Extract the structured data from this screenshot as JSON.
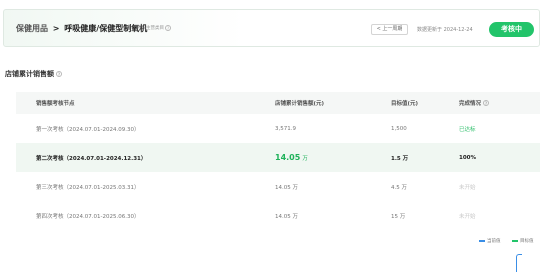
{
  "header": {
    "crumb_parent": "保健用品",
    "crumb_sep": ">",
    "crumb_current": "呼吸健康/保健型制氧机",
    "crumb_note": "考核主营类目",
    "period_button": "< 上一周期",
    "update_text": "数据更新于 2024-12-24",
    "status_label": "考核中",
    "status_color": "#22c46a"
  },
  "section": {
    "title": "店铺累计销售额"
  },
  "table": {
    "columns": [
      "销售额考核节点",
      "店铺累计销售额(元)",
      "目标值(元)",
      "完成情况"
    ],
    "rows": [
      {
        "node": "第一次考核（2024.07.01-2024.09.30）",
        "sales": "3,571.9",
        "sales_unit": "",
        "target": "1,500",
        "status": "已达标",
        "state": "done"
      },
      {
        "node": "第二次考核（2024.07.01-2024.12.31）",
        "sales": "14.05",
        "sales_unit": "万",
        "target": "1.5 万",
        "status": "100%",
        "state": "current"
      },
      {
        "node": "第三次考核（2024.07.01-2025.03.31）",
        "sales": "14.05 万",
        "sales_unit": "",
        "target": "4.5 万",
        "status": "未开始",
        "state": "pending"
      },
      {
        "node": "第四次考核（2024.07.01-2025.06.30）",
        "sales": "14.05 万",
        "sales_unit": "",
        "target": "15 万",
        "status": "未开始",
        "state": "pending"
      }
    ]
  },
  "legend": {
    "items": [
      {
        "label": "当前值",
        "color": "#3a8ee6"
      },
      {
        "label": "目标值",
        "color": "#22c46a"
      }
    ]
  }
}
